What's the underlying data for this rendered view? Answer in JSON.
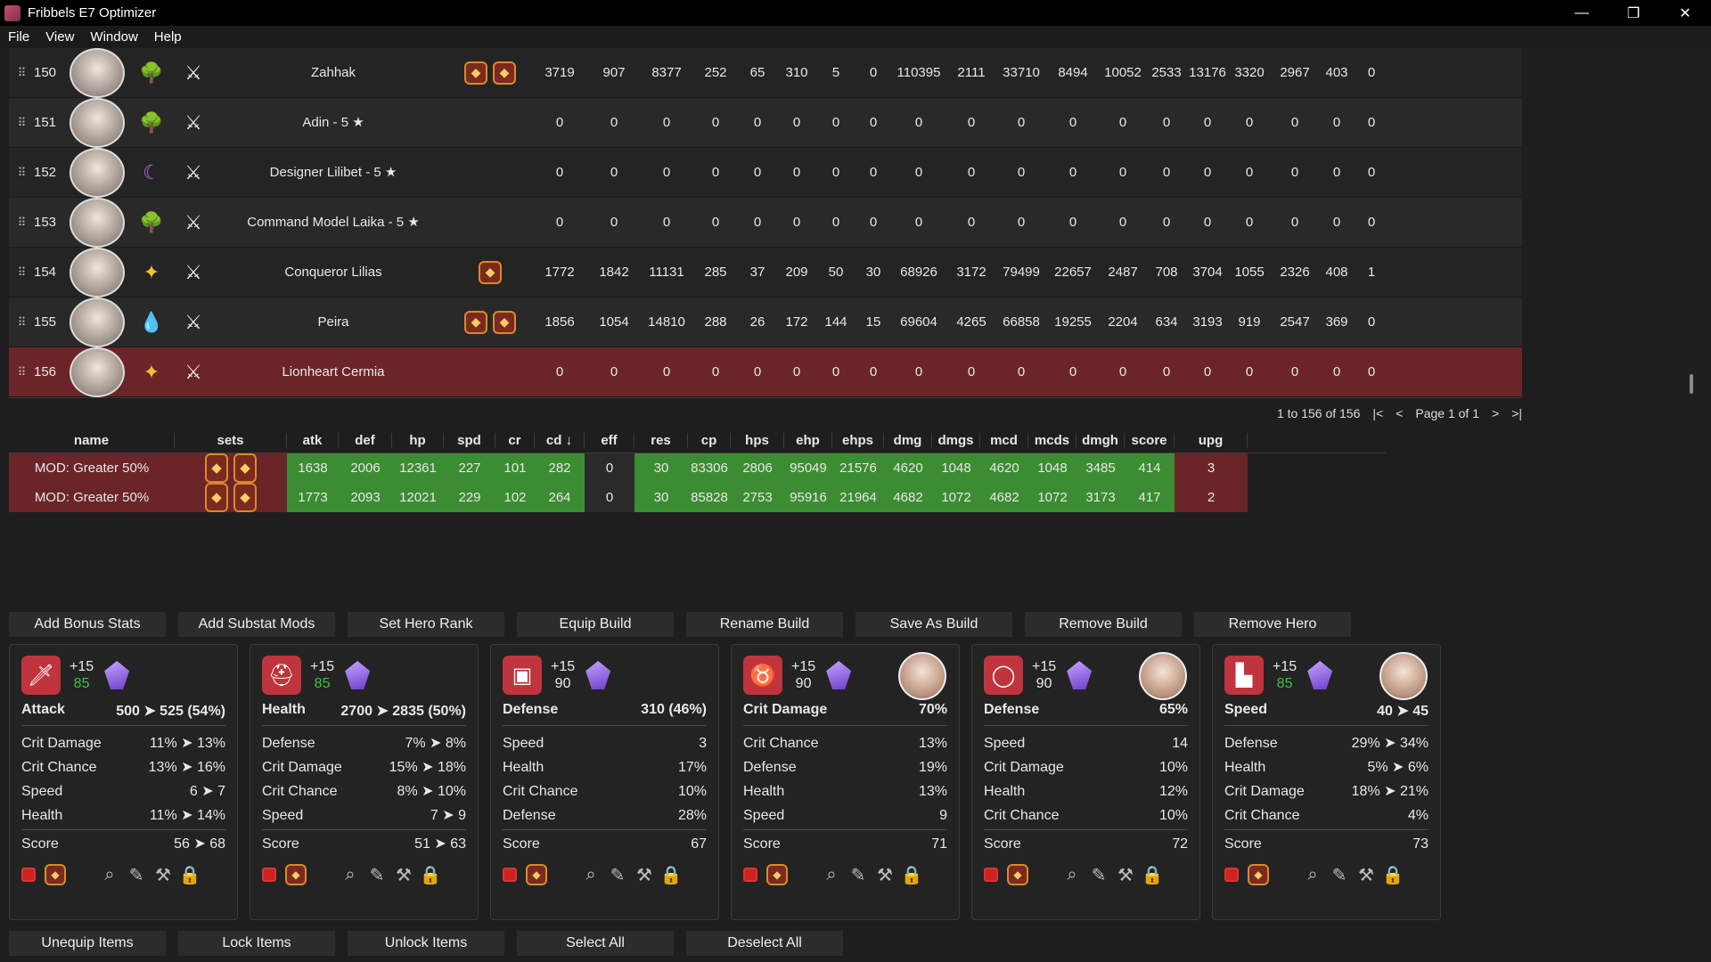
{
  "window": {
    "title": "Fribbels E7 Optimizer",
    "minimize": "—",
    "maximize": "❐",
    "close": "✕"
  },
  "menu": [
    "File",
    "View",
    "Window",
    "Help"
  ],
  "heroes": [
    {
      "num": "150",
      "name": "Zahhak",
      "element": "earth",
      "sets": 2,
      "stats": [
        "3719",
        "907",
        "8377",
        "252",
        "65",
        "310",
        "5",
        "0",
        "110395",
        "2111",
        "33710",
        "8494",
        "10052",
        "2533",
        "13176",
        "3320",
        "2967",
        "403",
        "0"
      ]
    },
    {
      "num": "151",
      "name": "Adin - 5 ★",
      "element": "earth",
      "sets": 0,
      "stats": [
        "0",
        "0",
        "0",
        "0",
        "0",
        "0",
        "0",
        "0",
        "0",
        "0",
        "0",
        "0",
        "0",
        "0",
        "0",
        "0",
        "0",
        "0",
        "0"
      ]
    },
    {
      "num": "152",
      "name": "Designer Lilibet - 5 ★",
      "element": "dark",
      "sets": 0,
      "stats": [
        "0",
        "0",
        "0",
        "0",
        "0",
        "0",
        "0",
        "0",
        "0",
        "0",
        "0",
        "0",
        "0",
        "0",
        "0",
        "0",
        "0",
        "0",
        "0"
      ]
    },
    {
      "num": "153",
      "name": "Command Model Laika - 5 ★",
      "element": "earth",
      "sets": 0,
      "stats": [
        "0",
        "0",
        "0",
        "0",
        "0",
        "0",
        "0",
        "0",
        "0",
        "0",
        "0",
        "0",
        "0",
        "0",
        "0",
        "0",
        "0",
        "0",
        "0"
      ]
    },
    {
      "num": "154",
      "name": "Conqueror Lilias",
      "element": "light",
      "sets": 1,
      "stats": [
        "1772",
        "1842",
        "11131",
        "285",
        "37",
        "209",
        "50",
        "30",
        "68926",
        "3172",
        "79499",
        "22657",
        "2487",
        "708",
        "3704",
        "1055",
        "2326",
        "408",
        "1"
      ]
    },
    {
      "num": "155",
      "name": "Peira",
      "element": "ice",
      "sets": 2,
      "stats": [
        "1856",
        "1054",
        "14810",
        "288",
        "26",
        "172",
        "144",
        "15",
        "69604",
        "4265",
        "66858",
        "19255",
        "2204",
        "634",
        "3193",
        "919",
        "2547",
        "369",
        "0"
      ]
    },
    {
      "num": "156",
      "name": "Lionheart Cermia",
      "element": "light",
      "sets": 0,
      "selected": true,
      "stats": [
        "0",
        "0",
        "0",
        "0",
        "0",
        "0",
        "0",
        "0",
        "0",
        "0",
        "0",
        "0",
        "0",
        "0",
        "0",
        "0",
        "0",
        "0",
        "0"
      ]
    }
  ],
  "pager": {
    "range": "1 to 156 of 156",
    "page": "Page 1 of 1"
  },
  "build_headers": [
    "name",
    "sets",
    "atk",
    "def",
    "hp",
    "spd",
    "cr",
    "cd ↓",
    "eff",
    "res",
    "cp",
    "hps",
    "ehp",
    "ehps",
    "dmg",
    "dmgs",
    "mcd",
    "mcds",
    "dmgh",
    "score",
    "upg"
  ],
  "builds": [
    {
      "name": "MOD: Greater 50%",
      "vals": [
        "1638",
        "2006",
        "12361",
        "227",
        "101",
        "282",
        "0",
        "30",
        "83306",
        "2806",
        "95049",
        "21576",
        "4620",
        "1048",
        "4620",
        "1048",
        "3485",
        "414",
        "3"
      ]
    },
    {
      "name": "MOD: Greater 50%",
      "vals": [
        "1773",
        "2093",
        "12021",
        "229",
        "102",
        "264",
        "0",
        "30",
        "85828",
        "2753",
        "95916",
        "21964",
        "4682",
        "1072",
        "4682",
        "1072",
        "3173",
        "417",
        "2"
      ]
    }
  ],
  "actions": [
    "Add Bonus Stats",
    "Add Substat Mods",
    "Set Hero Rank",
    "Equip Build",
    "Rename Build",
    "Save As Build",
    "Remove Build",
    "Remove Hero"
  ],
  "bottom_actions": [
    "Unequip Items",
    "Lock Items",
    "Unlock Items",
    "Select All",
    "Deselect All"
  ],
  "items": [
    {
      "slot": "weapon",
      "enh": "+15",
      "level": "85",
      "green": true,
      "main": "Attack",
      "main_val": "500 ➤ 525 (54%)",
      "owner": false,
      "subs": [
        [
          "Crit Damage",
          "11% ➤ 13%"
        ],
        [
          "Crit Chance",
          "13% ➤ 16%"
        ],
        [
          "Speed",
          "6 ➤ 7"
        ],
        [
          "Health",
          "11% ➤ 14%"
        ]
      ],
      "score_label": "Score",
      "score": "56 ➤ 68"
    },
    {
      "slot": "helmet",
      "enh": "+15",
      "level": "85",
      "green": true,
      "main": "Health",
      "main_val": "2700 ➤ 2835 (50%)",
      "owner": false,
      "subs": [
        [
          "Defense",
          "7% ➤ 8%"
        ],
        [
          "Crit Damage",
          "15% ➤ 18%"
        ],
        [
          "Crit Chance",
          "8% ➤ 10%"
        ],
        [
          "Speed",
          "7 ➤ 9"
        ]
      ],
      "score_label": "Score",
      "score": "51 ➤ 63"
    },
    {
      "slot": "armor",
      "enh": "+15",
      "level": "90",
      "green": false,
      "main": "Defense",
      "main_val": "310 (46%)",
      "owner": false,
      "subs": [
        [
          "Speed",
          "3"
        ],
        [
          "Health",
          "17%"
        ],
        [
          "Crit Chance",
          "10%"
        ],
        [
          "Defense",
          "28%"
        ]
      ],
      "score_label": "Score",
      "score": "67"
    },
    {
      "slot": "necklace",
      "enh": "+15",
      "level": "90",
      "green": false,
      "main": "Crit Damage",
      "main_val": "70%",
      "owner": true,
      "subs": [
        [
          "Crit Chance",
          "13%"
        ],
        [
          "Defense",
          "19%"
        ],
        [
          "Health",
          "13%"
        ],
        [
          "Speed",
          "9"
        ]
      ],
      "score_label": "Score",
      "score": "71"
    },
    {
      "slot": "ring",
      "enh": "+15",
      "level": "90",
      "green": false,
      "main": "Defense",
      "main_val": "65%",
      "owner": true,
      "subs": [
        [
          "Speed",
          "14"
        ],
        [
          "Crit Damage",
          "10%"
        ],
        [
          "Health",
          "12%"
        ],
        [
          "Crit Chance",
          "10%"
        ]
      ],
      "score_label": "Score",
      "score": "72"
    },
    {
      "slot": "boots",
      "enh": "+15",
      "level": "85",
      "green": true,
      "main": "Speed",
      "main_val": "40 ➤ 45",
      "owner": true,
      "subs": [
        [
          "Defense",
          "29% ➤ 34%"
        ],
        [
          "Health",
          "5% ➤ 6%"
        ],
        [
          "Crit Damage",
          "18% ➤ 21%"
        ],
        [
          "Crit Chance",
          "4%"
        ]
      ],
      "score_label": "Score",
      "score": "73"
    }
  ]
}
